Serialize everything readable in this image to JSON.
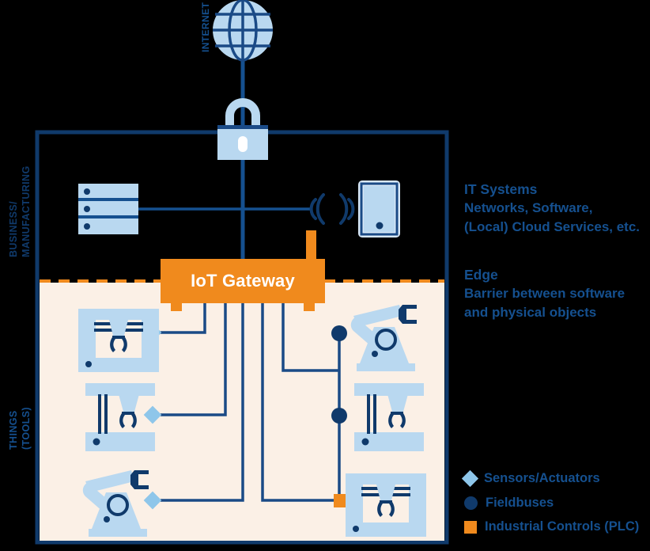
{
  "diagram": {
    "title_internet": "INTERNET",
    "gateway_label": "IoT Gateway",
    "side_labels": {
      "business": "BUSINESS/\nMANUFACTURING",
      "business_line1": "BUSINESS/",
      "business_line2": "MANUFACTURING",
      "things_line1": "THINGS",
      "things_line2": "(TOOLS)"
    },
    "annotations": {
      "it_heading": "IT Systems",
      "it_line1": "Networks, Software,",
      "it_line2": "(Local) Cloud Services, etc.",
      "edge_heading": "Edge",
      "edge_line1": "Barrier between software",
      "edge_line2": "and physical objects"
    },
    "legend": [
      {
        "label": "Sensors/Actuators",
        "marker": "diamond",
        "color": "#8ec6ea"
      },
      {
        "label": "Fieldbuses",
        "marker": "circle",
        "color": "#103a6b"
      },
      {
        "label": "Industrial Controls (PLC)",
        "marker": "square",
        "color": "#f08a1d"
      }
    ],
    "icons": {
      "globe": "globe-icon",
      "lock": "padlock-icon",
      "server": "server-rack-icon",
      "wireless": "wireless-signal-icon",
      "tablet": "tablet-icon",
      "machine": "machine-tool-icon",
      "press": "press-machine-icon",
      "robot": "robot-arm-icon"
    },
    "colors": {
      "brand_blue": "#15508f",
      "dark_navy": "#103a6b",
      "light_blue": "#b9d8f0",
      "pale_blue": "#8ec6ea",
      "orange": "#f08a1d",
      "cream": "#fbf0e6",
      "black": "#000000",
      "white": "#ffffff"
    }
  }
}
